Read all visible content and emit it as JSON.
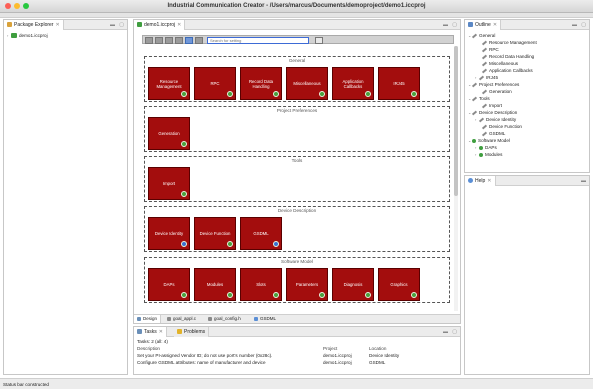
{
  "window": {
    "title": "Industrial Communication Creator - /Users/marcus/Documents/demoproject/demo1.iccproj"
  },
  "package_explorer": {
    "tab_label": "Package Explorer",
    "items": [
      {
        "label": "demo1.iccproj"
      }
    ]
  },
  "editor": {
    "tab_label": "demo1.iccproj",
    "search": {
      "placeholder": "Search for setting"
    },
    "sections": [
      {
        "title": "General",
        "tiles": [
          "Resource Management",
          "RPC",
          "Record Data Handling",
          "Miscellaneous",
          "Application Callbacks",
          "IRJ45"
        ]
      },
      {
        "title": "Project Preferences",
        "tiles": [
          "Generation"
        ]
      },
      {
        "title": "Tools",
        "tiles": [
          "Import"
        ]
      },
      {
        "title": "Device Description",
        "tiles": [
          "Device Identity",
          "Device Function",
          "GSDML"
        ]
      },
      {
        "title": "Software Model",
        "tiles": [
          "DAPs",
          "Modules",
          "Slots",
          "Parameters",
          "Diagnosis",
          "Graphics"
        ]
      }
    ],
    "bottom_tabs": [
      "Design",
      "goal_appl.c",
      "goal_config.h",
      "GSDML"
    ]
  },
  "outline": {
    "tab_label": "Outline",
    "tree": [
      "General",
      "Resource Management",
      "RPC",
      "Record Data Handling",
      "Miscellaneous",
      "Application Callbacks",
      "IRJ45",
      "Project Preferences",
      "Generation",
      "Tools",
      "Import",
      "Device Description",
      "Device Identity",
      "Device Function",
      "GSDML",
      "Software Model",
      "DAPs",
      "Modules"
    ]
  },
  "help": {
    "tab_label": "Help"
  },
  "tasks": {
    "tab_label": "Tasks",
    "problems_tab_label": "Problems",
    "summary": "Tasks: 2 (all: 4)",
    "columns": [
      "Description",
      "Project",
      "Location"
    ],
    "rows": [
      {
        "description": "Set your PI-assigned Vendor ID; do not use port's number (0x28c).",
        "project": "demo1.iccproj",
        "location": "Device Identity"
      },
      {
        "description": "Configure GSDML attributes: name of manufacturer and device",
        "project": "demo1.iccproj",
        "location": "GSDML"
      }
    ]
  },
  "status_bar": {
    "text": "Status bar constructed"
  },
  "colors": {
    "tile_red": "#a30d0d",
    "badge_green": "#49a03c",
    "badge_blue": "#3a6fd0"
  }
}
